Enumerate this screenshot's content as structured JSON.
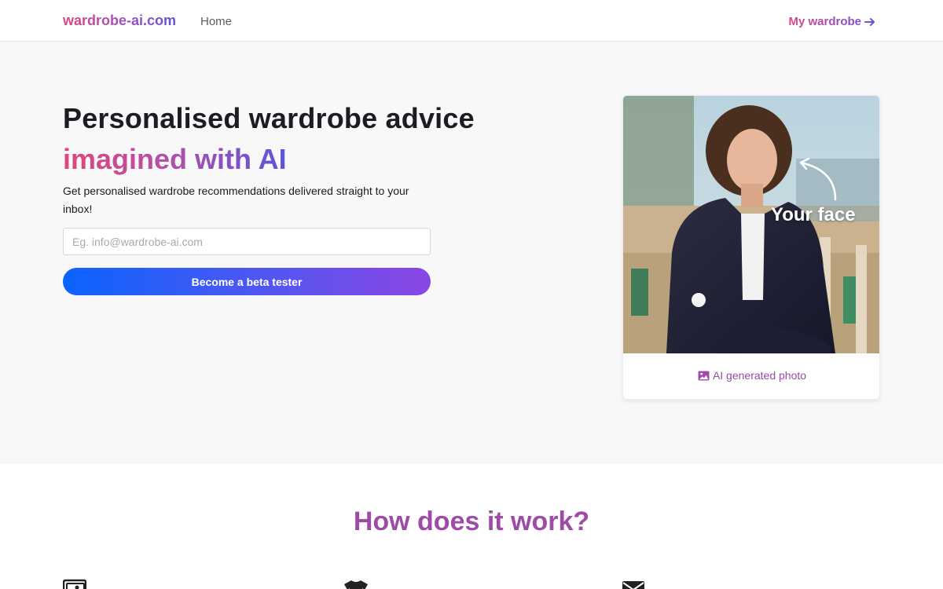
{
  "nav": {
    "brand": "wardrobe-ai.com",
    "home_label": "Home",
    "wardrobe_label": "My wardrobe",
    "wardrobe_icon": "arrow-right-icon"
  },
  "hero": {
    "headline": "Personalised wardrobe advice",
    "headline_accent": "imagined with AI",
    "subtext": "Get personalised wardrobe recommendations delivered straight to your inbox!",
    "email_placeholder": "Eg. info@wardrobe-ai.com",
    "email_value": "",
    "cta_label": "Become a beta tester"
  },
  "photo_card": {
    "overlay_text": "Your face",
    "caption": "AI generated photo",
    "caption_icon": "image-icon"
  },
  "how_it_works": {
    "title": "How does it work?",
    "step_icons": [
      "gallery-icon",
      "shirt-icon",
      "envelope-icon"
    ]
  },
  "colors": {
    "brand_pink": "#e0467c",
    "brand_purple": "#9a4fc4",
    "brand_blue": "#0b63ff",
    "section_title": "#a04aa8",
    "hero_bg": "#f8f8f9"
  }
}
